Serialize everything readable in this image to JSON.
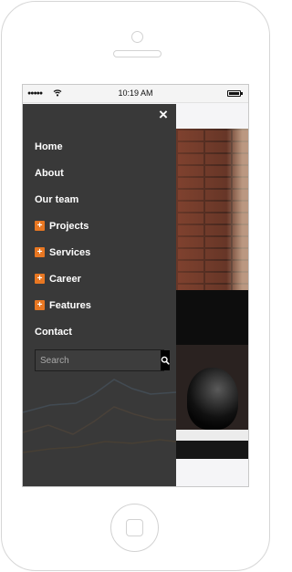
{
  "status_bar": {
    "signal": "●●●●●",
    "time": "10:19 AM"
  },
  "menu": {
    "close_label": "×",
    "items": [
      {
        "label": "Home",
        "expandable": false
      },
      {
        "label": "About",
        "expandable": false
      },
      {
        "label": "Our team",
        "expandable": false
      },
      {
        "label": "Projects",
        "expandable": true
      },
      {
        "label": "Services",
        "expandable": true
      },
      {
        "label": "Career",
        "expandable": true
      },
      {
        "label": "Features",
        "expandable": true
      },
      {
        "label": "Contact",
        "expandable": false
      }
    ],
    "expand_symbol": "+"
  },
  "search": {
    "placeholder": "Search"
  },
  "colors": {
    "menu_background": "#393939",
    "accent": "#e87722",
    "text": "#ffffff"
  }
}
